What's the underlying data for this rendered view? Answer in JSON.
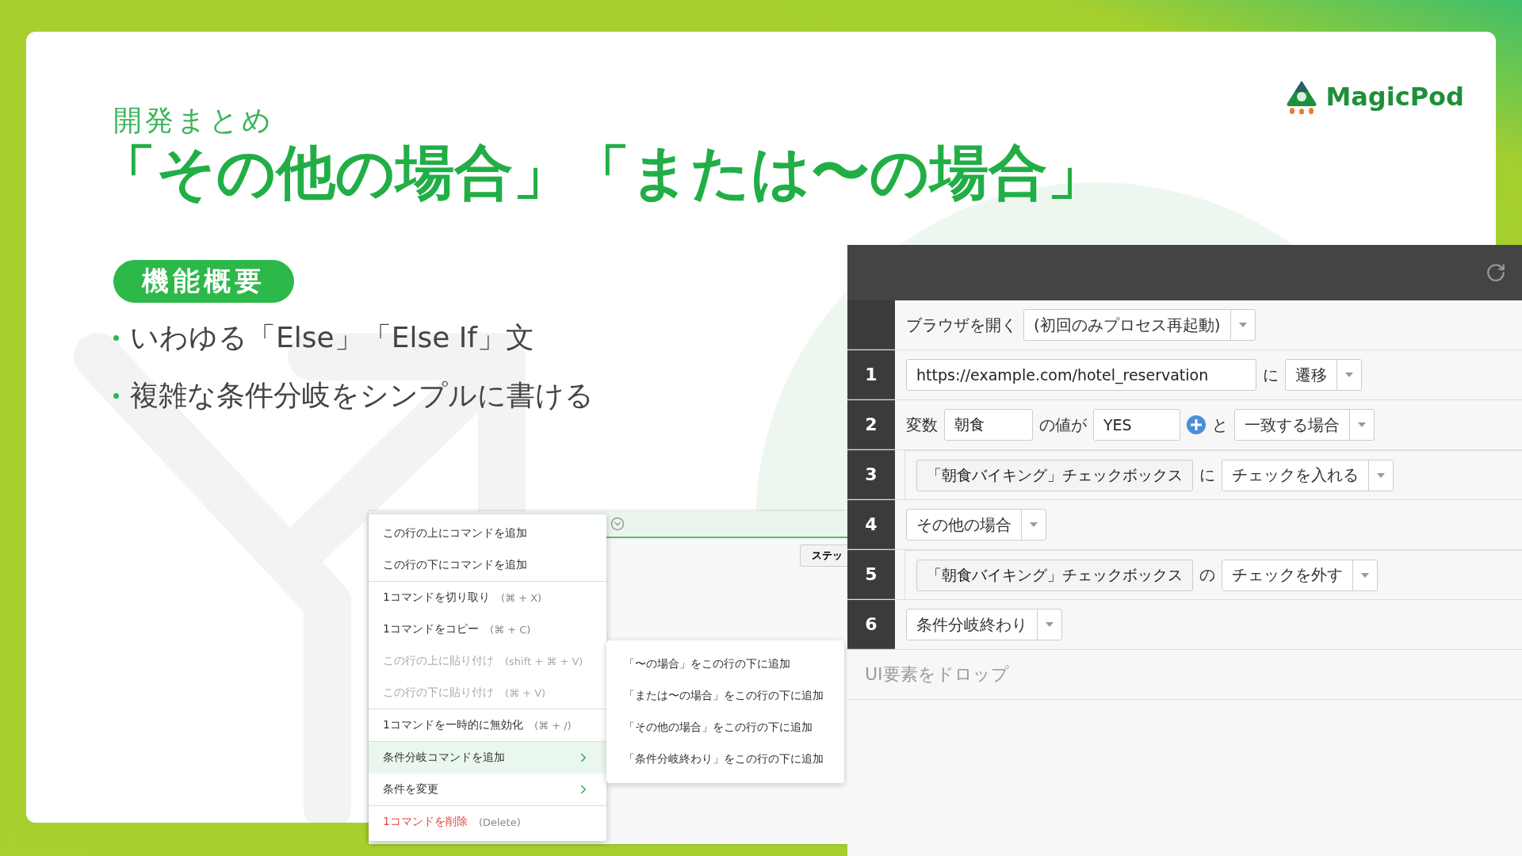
{
  "slide": {
    "section": "開発まとめ",
    "title": "「その他の場合」「または〜の場合」",
    "badge": "機能概要",
    "bullets": [
      "いわゆる「Else」「Else If」文",
      "複雑な条件分岐をシンプルに書ける"
    ]
  },
  "logo": {
    "text": "MagicPod"
  },
  "background_window": {
    "button": "ステッ"
  },
  "context_menu": {
    "groups": [
      {
        "items": [
          {
            "label": "この行の上にコマンドを追加",
            "kind": "normal",
            "disabled": false,
            "selected": false
          },
          {
            "label": "この行の下にコマンドを追加",
            "kind": "normal",
            "disabled": false,
            "selected": false
          }
        ]
      },
      {
        "items": [
          {
            "label": "1コマンドを切り取り",
            "shortcut": "(⌘ + X)",
            "kind": "normal",
            "disabled": false,
            "selected": false
          },
          {
            "label": "1コマンドをコピー",
            "shortcut": "(⌘ + C)",
            "kind": "normal",
            "disabled": false,
            "selected": false
          },
          {
            "label": "この行の上に貼り付け",
            "shortcut": "(shift + ⌘ + V)",
            "kind": "normal",
            "disabled": true,
            "selected": false
          },
          {
            "label": "この行の下に貼り付け",
            "shortcut": "(⌘ + V)",
            "kind": "normal",
            "disabled": true,
            "selected": false
          }
        ]
      },
      {
        "items": [
          {
            "label": "1コマンドを一時的に無効化",
            "shortcut": "(⌘ + /)",
            "kind": "normal",
            "disabled": false,
            "selected": false
          }
        ]
      },
      {
        "items": [
          {
            "label": "条件分岐コマンドを追加",
            "kind": "submenu",
            "disabled": false,
            "selected": true
          },
          {
            "label": "条件を変更",
            "kind": "submenu",
            "disabled": false,
            "selected": false
          }
        ]
      },
      {
        "items": [
          {
            "label": "1コマンドを削除",
            "shortcut": "(Delete)",
            "kind": "danger",
            "disabled": false,
            "selected": false
          }
        ]
      }
    ]
  },
  "submenu": {
    "items": [
      "「〜の場合」をこの行の下に追加",
      "「または〜の場合」をこの行の下に追加",
      "「その他の場合」をこの行の下に追加",
      "「条件分岐終わり」をこの行の下に追加"
    ]
  },
  "editor": {
    "steps": [
      {
        "nested": false,
        "parts": [
          {
            "kind": "text",
            "text": "ブラウザを開く"
          },
          {
            "kind": "select",
            "text": "(初回のみプロセス再起動)"
          }
        ]
      },
      {
        "number": "1",
        "nested": false,
        "parts": [
          {
            "kind": "field",
            "text": "https://example.com/hotel_reservation"
          },
          {
            "kind": "text",
            "text": "に"
          },
          {
            "kind": "select",
            "text": "遷移"
          }
        ]
      },
      {
        "number": "2",
        "nested": false,
        "parts": [
          {
            "kind": "text",
            "text": "変数"
          },
          {
            "kind": "field",
            "text": "朝食"
          },
          {
            "kind": "text",
            "text": "の値が"
          },
          {
            "kind": "field",
            "text": "YES"
          },
          {
            "kind": "add"
          },
          {
            "kind": "text",
            "text": "と"
          },
          {
            "kind": "select",
            "text": "一致する場合"
          }
        ]
      },
      {
        "number": "3",
        "nested": true,
        "parts": [
          {
            "kind": "element",
            "text": "「朝食バイキング」チェックボックス"
          },
          {
            "kind": "text",
            "text": "に"
          },
          {
            "kind": "select",
            "text": "チェックを入れる"
          }
        ]
      },
      {
        "number": "4",
        "nested": false,
        "parts": [
          {
            "kind": "select",
            "text": "その他の場合"
          }
        ]
      },
      {
        "number": "5",
        "nested": true,
        "parts": [
          {
            "kind": "element",
            "text": "「朝食バイキング」チェックボックス"
          },
          {
            "kind": "text",
            "text": "の"
          },
          {
            "kind": "select",
            "text": "チェックを外す"
          }
        ]
      },
      {
        "number": "6",
        "nested": false,
        "parts": [
          {
            "kind": "select",
            "text": "条件分岐終わり"
          }
        ]
      }
    ],
    "drop_hint": "UI要素をドロップ"
  }
}
